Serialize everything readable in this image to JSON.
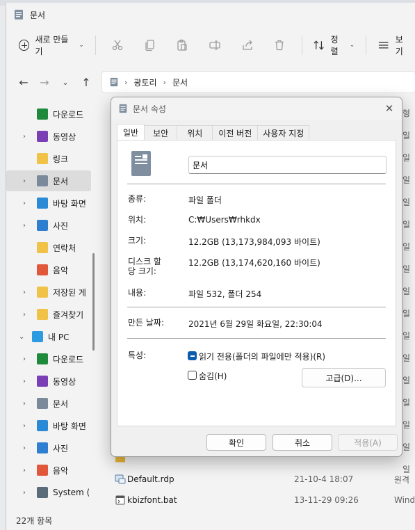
{
  "explorer": {
    "title": "문서",
    "toolbar": {
      "new_label": "새로 만들기",
      "sort_label": "정렬",
      "view_label": "보기",
      "icons": [
        "cut-icon",
        "copy-icon",
        "paste-icon",
        "rename-icon",
        "share-icon",
        "delete-icon"
      ]
    },
    "address": {
      "crumbs": [
        "광토리",
        "문서"
      ]
    },
    "sidebar": {
      "items": [
        {
          "label": "다운로드",
          "icon": "download-icon",
          "color": "#1f8a3b"
        },
        {
          "label": "동영상",
          "icon": "video-icon",
          "color": "#7a3fb5"
        },
        {
          "label": "링크",
          "icon": "folder-icon",
          "color": "#f0c248"
        },
        {
          "label": "문서",
          "icon": "document-icon",
          "color": "#7a8a9a"
        },
        {
          "label": "바탕 화면",
          "icon": "desktop-icon",
          "color": "#2b8ad6"
        },
        {
          "label": "사진",
          "icon": "pictures-icon",
          "color": "#2f7fd0"
        },
        {
          "label": "연락처",
          "icon": "folder-icon",
          "color": "#f0c248"
        },
        {
          "label": "음악",
          "icon": "music-icon",
          "color": "#e0573b"
        },
        {
          "label": "저장된 게",
          "icon": "folder-icon",
          "color": "#f0c248"
        },
        {
          "label": "즐겨찾기",
          "icon": "folder-icon",
          "color": "#f0c248"
        },
        {
          "label": "내 PC",
          "icon": "pc-icon",
          "color": "#2d9be0"
        },
        {
          "label": "다운로드",
          "icon": "download-icon",
          "color": "#1f8a3b"
        },
        {
          "label": "동영상",
          "icon": "video-icon",
          "color": "#7a3fb5"
        },
        {
          "label": "문서",
          "icon": "document-icon",
          "color": "#7a8a9a"
        },
        {
          "label": "바탕 화면",
          "icon": "desktop-icon",
          "color": "#2b8ad6"
        },
        {
          "label": "사진",
          "icon": "pictures-icon",
          "color": "#2f7fd0"
        },
        {
          "label": "음악",
          "icon": "music-icon",
          "color": "#e0573b"
        },
        {
          "label": "System (",
          "icon": "drive-icon",
          "color": "#5a6b7a"
        }
      ]
    },
    "files": [
      {
        "name": "Default.rdp",
        "date": "21-10-4 18:07",
        "type": "원격"
      },
      {
        "name": "kbizfont.bat",
        "date": "13-11-29 09:26",
        "type": "Windo"
      }
    ],
    "right_col": [
      "형",
      "일 ",
      "일 ",
      "일 ",
      "일 ",
      "일 ",
      "일 ",
      "일 ",
      "일 ",
      "일 ",
      "일 ",
      "일 ",
      "일 ",
      "일 ",
      "일 ",
      "일 ",
      "일 "
    ],
    "status": "22개 항목"
  },
  "dialog": {
    "title": "문서 속성",
    "tabs": [
      "일반",
      "보안",
      "위치",
      "이전 버전",
      "사용자 지정"
    ],
    "name_value": "문서",
    "fields": {
      "type_label": "종류:",
      "type_value": "파일 폴더",
      "location_label": "위치:",
      "location_value": "C:₩Users₩rhkdx",
      "size_label": "크기:",
      "size_value": "12.2GB (13,173,984,093 바이트)",
      "disk_label": "디스크 할\n당 크기:",
      "disk_value": "12.2GB (13,174,620,160 바이트)",
      "contents_label": "내용:",
      "contents_value": "파일 532, 폴더 254",
      "created_label": "만든 날짜:",
      "created_value": "2021년 6월 29일 화요일, 22:30:04",
      "attrs_label": "특성:",
      "readonly_label": "읽기 전용(폴더의 파일에만 적용)(R)",
      "hidden_label": "숨김(H)",
      "advanced_label": "고급(D)..."
    },
    "buttons": {
      "ok": "확인",
      "cancel": "취소",
      "apply": "적용(A)"
    }
  }
}
